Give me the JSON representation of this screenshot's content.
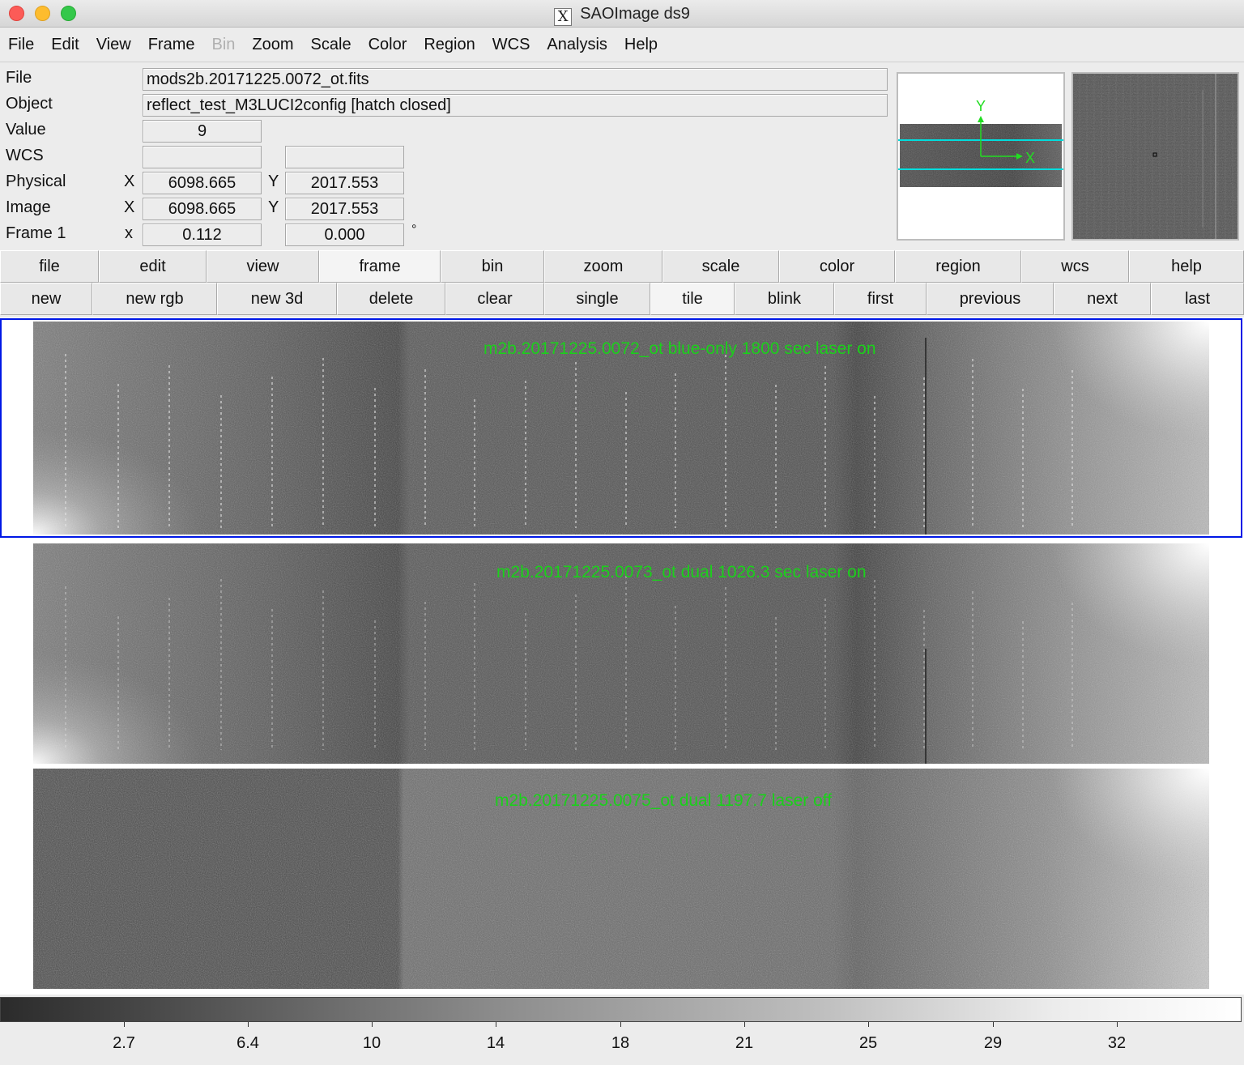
{
  "window": {
    "title": "SAOImage ds9",
    "app_icon": "x11-icon"
  },
  "menu": [
    "File",
    "Edit",
    "View",
    "Frame",
    "Bin",
    "Zoom",
    "Scale",
    "Color",
    "Region",
    "WCS",
    "Analysis",
    "Help"
  ],
  "menu_disabled": [
    "Bin"
  ],
  "info": {
    "file_label": "File",
    "file_value": "mods2b.20171225.0072_ot.fits",
    "object_label": "Object",
    "object_value": "reflect_test_M3LUCI2config [hatch closed]",
    "value_label": "Value",
    "value_value": "9",
    "wcs_label": "WCS",
    "wcs_value_1": "",
    "wcs_value_2": "",
    "physical_label": "Physical",
    "physical_x_axis": "X",
    "physical_x": "6098.665",
    "physical_y_axis": "Y",
    "physical_y": "2017.553",
    "image_label": "Image",
    "image_x_axis": "X",
    "image_x": "6098.665",
    "image_y_axis": "Y",
    "image_y": "2017.553",
    "frame_label": "Frame 1",
    "frame_zoom_axis": "x",
    "frame_zoom": "0.112",
    "frame_angle": "0.000",
    "frame_angle_unit": "°"
  },
  "panner": {
    "y_label": "Y",
    "x_label": "X",
    "compass_color": "#22dd22",
    "bbox_color": "#00dddd"
  },
  "buttonbar_main": [
    "file",
    "edit",
    "view",
    "frame",
    "bin",
    "zoom",
    "scale",
    "color",
    "region",
    "wcs",
    "help"
  ],
  "buttonbar_main_active": "frame",
  "buttonbar_frame": [
    "new",
    "new rgb",
    "new 3d",
    "delete",
    "clear",
    "single",
    "tile",
    "blink",
    "first",
    "previous",
    "next",
    "last"
  ],
  "buttonbar_frame_active": "tile",
  "frames": [
    {
      "caption": "m2b.20171225.0072_ot blue-only 1800 sec laser on",
      "selected": true
    },
    {
      "caption": "m2b.20171225.0073_ot dual 1026.3 sec laser on",
      "selected": false
    },
    {
      "caption": "m2b.20171225.0075_ot dual 1197.7 laser off",
      "selected": false
    }
  ],
  "overlay_text_color": "#1bd01b",
  "selection_color": "#0018e6",
  "colorbar": {
    "colormap": "grey",
    "ticks": [
      "2.7",
      "6.4",
      "10",
      "14",
      "18",
      "21",
      "25",
      "29",
      "32"
    ]
  }
}
